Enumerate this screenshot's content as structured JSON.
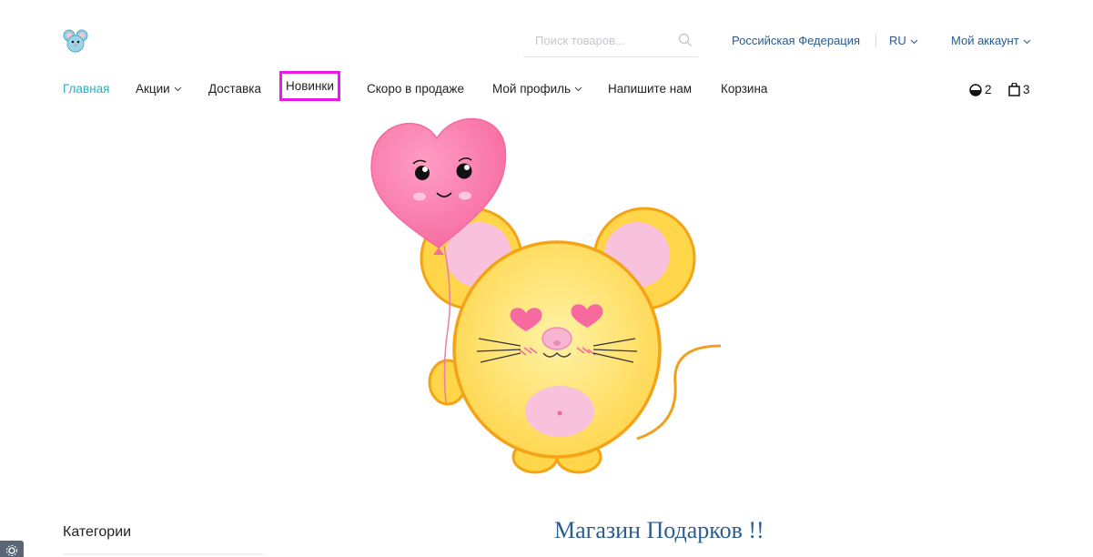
{
  "header": {
    "logo_icon": "mouse-logo-icon",
    "search": {
      "placeholder": "Поиск товаров...",
      "value": ""
    },
    "region": "Российская Федерация",
    "language": "RU",
    "account": "Мой аккаунт"
  },
  "nav": {
    "items": [
      {
        "label": "Главная",
        "active": true,
        "dropdown": false
      },
      {
        "label": "Акции",
        "active": false,
        "dropdown": true
      },
      {
        "label": "Доставка",
        "active": false,
        "dropdown": false
      },
      {
        "label": "Новинки",
        "active": false,
        "dropdown": false,
        "highlighted": true
      },
      {
        "label": "Скоро в продаже",
        "active": false,
        "dropdown": false
      },
      {
        "label": "Мой профиль",
        "active": false,
        "dropdown": true
      },
      {
        "label": "Напишите нам",
        "active": false,
        "dropdown": false
      },
      {
        "label": "Корзина",
        "active": false,
        "dropdown": false
      }
    ],
    "compare_count": "2",
    "cart_count": "3"
  },
  "banner": {
    "image": "yellow mouse holding a pink heart balloon"
  },
  "sidebar": {
    "title": "Категории"
  },
  "main": {
    "title": "Магазин Подарков !!"
  },
  "colors": {
    "accent": "#22b2c9",
    "link": "#2a5a8e",
    "highlight_box": "#ea19ea",
    "heading": "#2c5d91"
  }
}
